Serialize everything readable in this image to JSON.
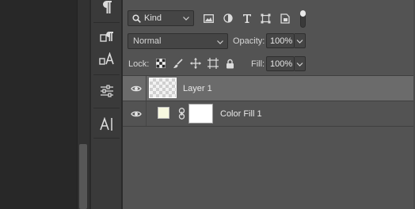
{
  "filter": {
    "kind_label": "Kind",
    "icons": [
      "image-filter-icon",
      "adjustment-filter-icon",
      "type-filter-icon",
      "shape-filter-icon",
      "smart-object-filter-icon"
    ]
  },
  "blend": {
    "mode": "Normal",
    "opacity_label": "Opacity:",
    "opacity_value": "100%"
  },
  "lock": {
    "label": "Lock:",
    "fill_label": "Fill:",
    "fill_value": "100%"
  },
  "layers": [
    {
      "name": "Layer 1",
      "selected": true,
      "visible": true
    },
    {
      "name": "Color Fill 1",
      "selected": false,
      "visible": true,
      "swatch_color": "#f7f8e0"
    }
  ],
  "colors": {
    "panel": "#535353",
    "selected_row": "#6b6b6b",
    "tool_column": "#3a3a3a"
  }
}
